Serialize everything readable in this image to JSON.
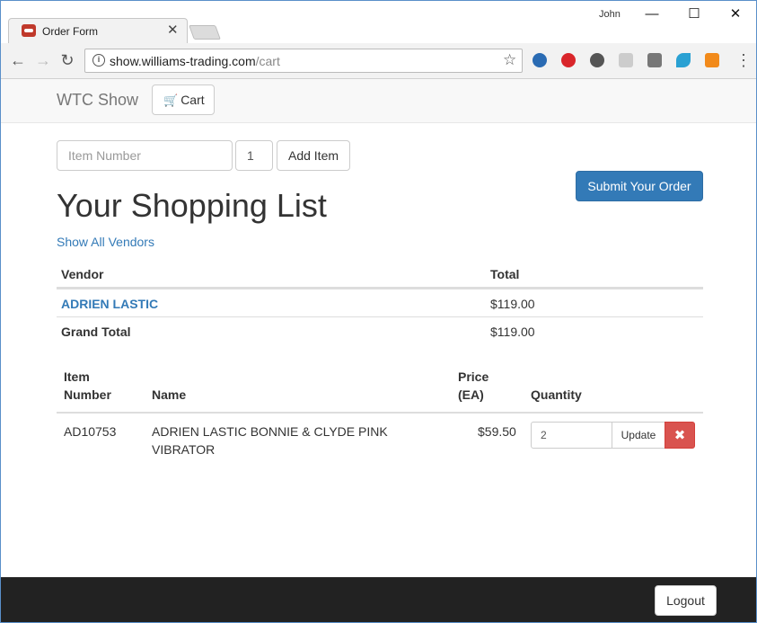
{
  "browser": {
    "tab_title": "Order Form",
    "tab_close": "✕",
    "user_name": "John",
    "minimize": "—",
    "maximize": "☐",
    "close": "✕",
    "url_host": "show.williams-trading.com",
    "url_path": "/cart",
    "back": "←",
    "forward": "→",
    "reload": "↻",
    "star": "☆",
    "menu": "⋮"
  },
  "navbar": {
    "brand": "WTC Show",
    "cart_label": "Cart",
    "cart_icon": "🛒"
  },
  "add_item": {
    "item_placeholder": "Item Number",
    "quantity_value": "1",
    "add_label": "Add Item"
  },
  "submit_label": "Submit Your Order",
  "page_title": "Your Shopping List",
  "show_vendors": "Show All Vendors",
  "vendor_table": {
    "headers": [
      "Vendor",
      "Total"
    ],
    "rows": [
      {
        "vendor": "ADRIEN LASTIC",
        "total": "$119.00"
      }
    ],
    "grand_total_label": "Grand Total",
    "grand_total": "$119.00"
  },
  "item_table": {
    "headers": {
      "item_number_1": "Item",
      "item_number_2": "Number",
      "name": "Name",
      "price_1": "Price",
      "price_2": "(EA)",
      "quantity": "Quantity"
    },
    "rows": [
      {
        "item_number": "AD10753",
        "name_line1": "ADRIEN LASTIC BONNIE & CLYDE PINK",
        "name_line2": "VIBRATOR",
        "price": "$59.50",
        "quantity": "2",
        "update_label": "Update",
        "remove_label": "✖"
      }
    ]
  },
  "footer": {
    "logout_label": "Logout"
  },
  "colors": {
    "primary": "#337ab7",
    "danger": "#d9534f",
    "footer": "#222222"
  }
}
